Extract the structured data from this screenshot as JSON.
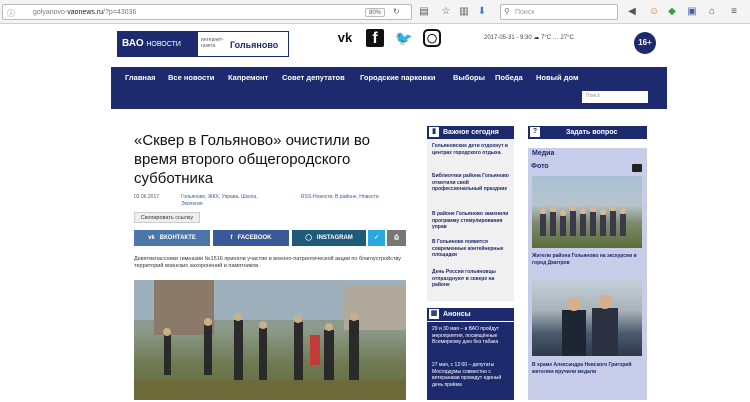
{
  "browser": {
    "url_prefix": "golyanovo-",
    "url_domain": "vaonews.ru",
    "url_suffix": "/?p=43036",
    "zoom": "80%",
    "search_placeholder": "Поиск"
  },
  "header": {
    "logo_main": "ВАО",
    "logo_sub": "НОВОСТИ",
    "logo_small_1": "интернет-",
    "logo_small_2": "газета",
    "district": "Гольяново",
    "social": [
      "vk-icon",
      "facebook-icon",
      "twitter-icon",
      "instagram-icon"
    ],
    "weather": "2017-05-31 - 9:30 ☁ 7°C … 27°C",
    "age_badge": "16+"
  },
  "nav": {
    "items": [
      "Главная",
      "Все новости",
      "Капремонт",
      "Совет депутатов",
      "Городские парковки",
      "Выборы",
      "Победа",
      "Новый дом"
    ],
    "search_placeholder": "Поиск"
  },
  "article": {
    "title": "«Сквер в Гольяново» очистили во время второго общегородского субботника",
    "date": "02.06.2017",
    "tags_1": "Гольяново, ЖКХ, Управа, Школа,",
    "tags_2": "Экология",
    "categories": "RSS-Новости, В районе, Новости",
    "copy_button": "Скопировать ссылку",
    "share": [
      "ВКОНТАКТЕ",
      "FACEBOOK",
      "INSTAGRAM"
    ],
    "lead": "Девятиклассники гимназии №1516 приняли участие в военно-патриотической акции по благоустройству территорий воинских захоронений и памятников."
  },
  "today": {
    "heading": "Важное сегодня",
    "items": [
      "Гольяновские дети отдохнут в центрах городского отдыха",
      "Библиотеки района Гольяново отметили свой профессиональный праздник",
      "В районе Гольяново заменили программу стимулирования управ",
      "В Гольянове появятся современные контейнерные площадки",
      "День России гольяновцы отпразднуют в сквере на районе"
    ]
  },
  "anons": {
    "heading": "Анонсы",
    "items": [
      "29 и 30 мая – в ВАО пройдут мероприятия, посвящённые Всемирному дню без табака",
      "27 мая, с 12:00 – депутаты Мосгордумы совместно с ветеранами проведут единый день приёма"
    ]
  },
  "sidebar": {
    "ask_button": "Задать вопрос",
    "media_heading": "Медиа",
    "photo_heading": "Фото",
    "caption_1": "Жители района Гольяново на экскурсии в город Дмитров",
    "caption_2": "В храме Александра Невского Григорий жителям вручили медали"
  }
}
